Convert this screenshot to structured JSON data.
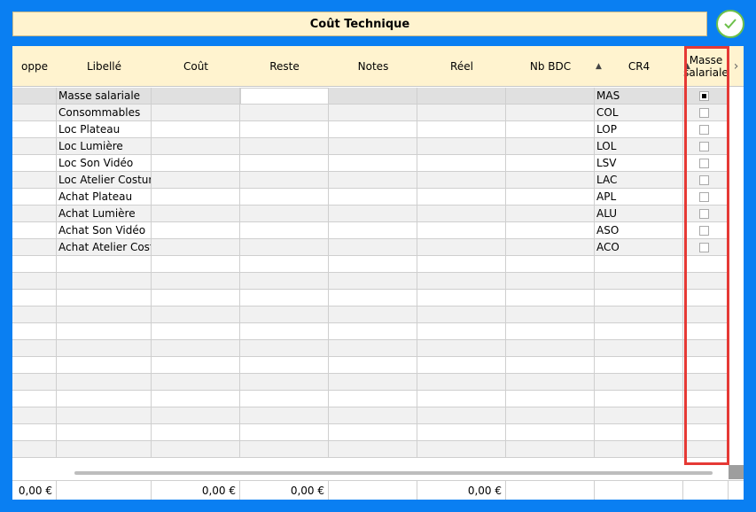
{
  "title": "Coût Technique",
  "columns": [
    "oppe",
    "Libellé",
    "Coût",
    "Reste",
    "Notes",
    "Réel",
    "Nb BDC",
    "CR4",
    "Masse",
    "salariale"
  ],
  "rows": [
    {
      "libelle": "Masse salariale",
      "cr4": "MAS",
      "checked": true
    },
    {
      "libelle": "Consommables",
      "cr4": "COL",
      "checked": false
    },
    {
      "libelle": "Loc Plateau",
      "cr4": "LOP",
      "checked": false
    },
    {
      "libelle": "Loc Lumière",
      "cr4": "LOL",
      "checked": false
    },
    {
      "libelle": "Loc Son Vidéo",
      "cr4": "LSV",
      "checked": false
    },
    {
      "libelle": "Loc Atelier Costume",
      "cr4": "LAC",
      "checked": false
    },
    {
      "libelle": "Achat Plateau",
      "cr4": "APL",
      "checked": false
    },
    {
      "libelle": "Achat Lumière",
      "cr4": "ALU",
      "checked": false
    },
    {
      "libelle": "Achat Son Vidéo",
      "cr4": "ASO",
      "checked": false
    },
    {
      "libelle": "Achat Atelier Costume",
      "cr4": "ACO",
      "checked": false
    }
  ],
  "footer": {
    "enveloppe": "0,00 €",
    "cout": "0,00 €",
    "reste": "0,00 €",
    "reel": "0,00 €"
  },
  "colors": {
    "accent": "#0a7ff2",
    "header": "#fff3cf",
    "highlight": "#e53935",
    "check": "#6cc04a"
  },
  "icons": {
    "ok": "check-icon",
    "sort": "sort-icon",
    "scroll": "chevron-right-icon"
  }
}
